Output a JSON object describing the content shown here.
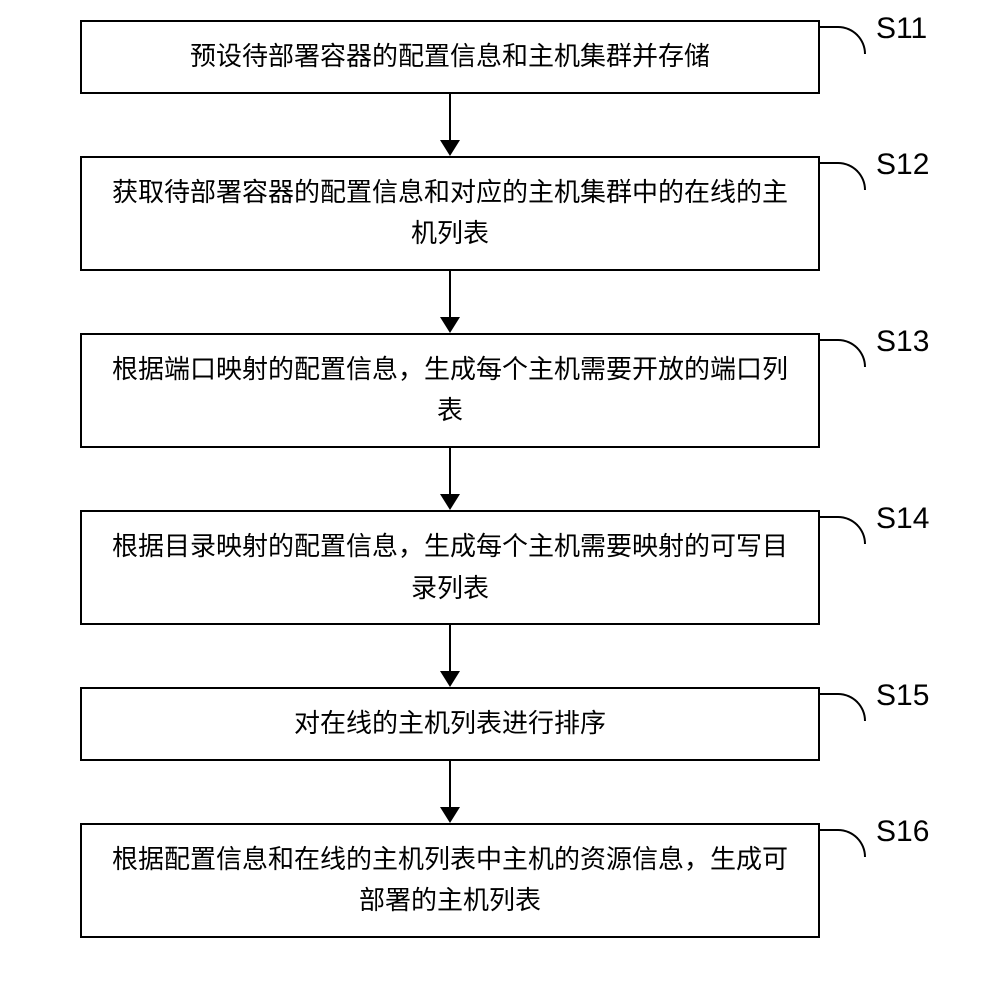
{
  "flowchart": {
    "steps": [
      {
        "label": "S11",
        "text": "预设待部署容器的配置信息和主机集群并存储",
        "lines": "single"
      },
      {
        "label": "S12",
        "text": "获取待部署容器的配置信息和对应的主机集群中的在线的主机列表",
        "lines": "double"
      },
      {
        "label": "S13",
        "text": "根据端口映射的配置信息，生成每个主机需要开放的端口列表",
        "lines": "double"
      },
      {
        "label": "S14",
        "text": "根据目录映射的配置信息，生成每个主机需要映射的可写目录列表",
        "lines": "double"
      },
      {
        "label": "S15",
        "text": "对在线的主机列表进行排序",
        "lines": "single"
      },
      {
        "label": "S16",
        "text": "根据配置信息和在线的主机列表中主机的资源信息，生成可部署的主机列表",
        "lines": "double"
      }
    ]
  }
}
